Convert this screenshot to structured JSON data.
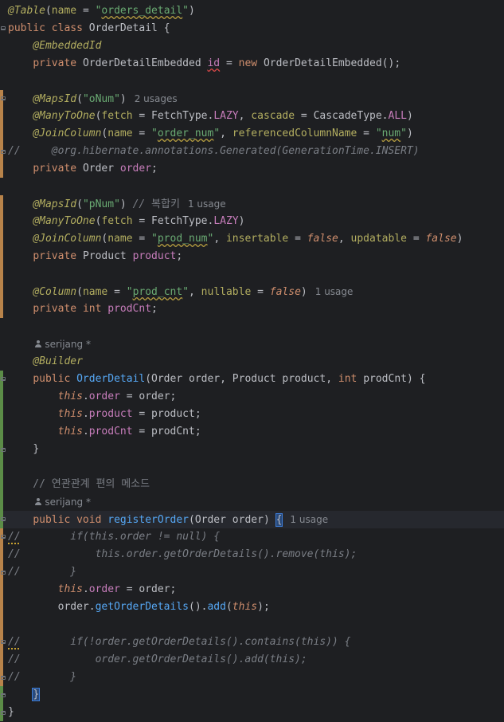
{
  "editor": {
    "language": "Java",
    "current_line": 29,
    "colors": {
      "background": "#1e1f22",
      "keyword": "#cf8e6d",
      "annotation": "#b3ae60",
      "string": "#6aab73",
      "field": "#c77dbb",
      "method": "#56a8f5",
      "comment": "#7a7e85",
      "gutter_added": "#5b8c47",
      "gutter_modified": "#b8834a"
    },
    "lines": [
      {
        "code": "@Table(name = \"orders_detail\")"
      },
      {
        "code": "public class OrderDetail {"
      },
      {
        "code": "    @EmbeddedId"
      },
      {
        "code": "    private OrderDetailEmbedded id = new OrderDetailEmbedded();"
      },
      {
        "code": ""
      },
      {
        "code": "    @MapsId(\"oNum\")",
        "hint": "2 usages"
      },
      {
        "code": "    @ManyToOne(fetch = FetchType.LAZY, cascade = CascadeType.ALL)"
      },
      {
        "code": "    @JoinColumn(name = \"order_num\", referencedColumnName = \"num\")"
      },
      {
        "code": "//     @org.hibernate.annotations.Generated(GenerationTime.INSERT)"
      },
      {
        "code": "    private Order order;"
      },
      {
        "code": ""
      },
      {
        "code": "    @MapsId(\"pNum\") // 복합키",
        "hint": "1 usage"
      },
      {
        "code": "    @ManyToOne(fetch = FetchType.LAZY)"
      },
      {
        "code": "    @JoinColumn(name = \"prod_num\", insertable = false, updatable = false)"
      },
      {
        "code": "    private Product product;"
      },
      {
        "code": ""
      },
      {
        "code": "    @Column(name = \"prod_cnt\", nullable = false)",
        "hint": "1 usage"
      },
      {
        "code": "    private int prodCnt;"
      },
      {
        "code": ""
      },
      {
        "code": "    ",
        "author": "serijang *"
      },
      {
        "code": "    @Builder"
      },
      {
        "code": "    public OrderDetail(Order order, Product product, int prodCnt) {"
      },
      {
        "code": "        this.order = order;"
      },
      {
        "code": "        this.product = product;"
      },
      {
        "code": "        this.prodCnt = prodCnt;"
      },
      {
        "code": "    }"
      },
      {
        "code": ""
      },
      {
        "code": "    // 연관관계 편의 메소드"
      },
      {
        "code": "    ",
        "author": "serijang *"
      },
      {
        "code": "    public void registerOrder(Order order) {",
        "hint": "1 usage"
      },
      {
        "code": "//        if(this.order != null) {"
      },
      {
        "code": "//            this.order.getOrderDetails().remove(this);"
      },
      {
        "code": "//        }"
      },
      {
        "code": "        this.order = order;"
      },
      {
        "code": "        order.getOrderDetails().add(this);"
      },
      {
        "code": ""
      },
      {
        "code": "//        if(!order.getOrderDetails().contains(this)) {"
      },
      {
        "code": "//            order.getOrderDetails().add(this);"
      },
      {
        "code": "//        }"
      },
      {
        "code": "    }"
      },
      {
        "code": "}"
      }
    ]
  }
}
